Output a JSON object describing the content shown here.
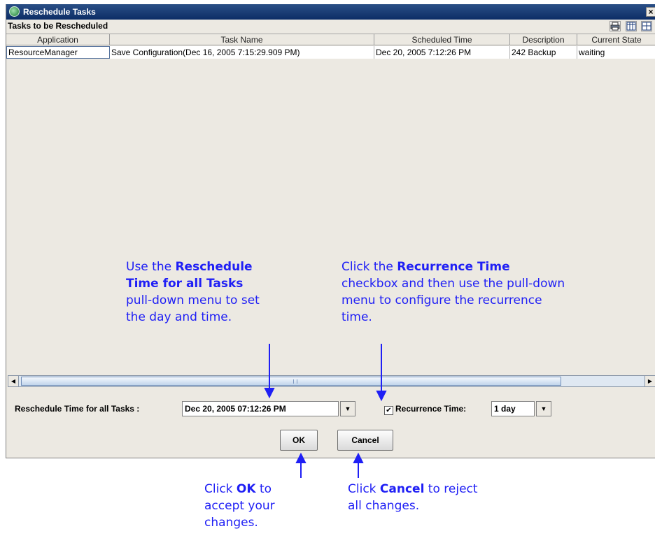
{
  "window": {
    "title": "Reschedule Tasks",
    "close_label": "×",
    "section_label": "Tasks to be Rescheduled"
  },
  "toolbar": {
    "icons": [
      "print-icon",
      "grid-columns-icon",
      "grid-layout-icon"
    ]
  },
  "table": {
    "columns": [
      "Application",
      "Task Name",
      "Scheduled Time",
      "Description",
      "Current State"
    ],
    "rows": [
      [
        "ResourceManager",
        "Save Configuration(Dec 16, 2005 7:15:29.909 PM)",
        "Dec 20, 2005 7:12:26 PM",
        "242 Backup",
        "waiting"
      ]
    ]
  },
  "scrollbar": {
    "left_arrow": "◀",
    "right_arrow": "▶"
  },
  "bottom": {
    "reschedule_label": "Reschedule Time for all Tasks :",
    "reschedule_value": "Dec 20, 2005 07:12:26 PM",
    "recurrence_checked_glyph": "✔",
    "recurrence_label": "Recurrence Time:",
    "recurrence_value": "1 day",
    "dropdown_glyph": "▼",
    "ok_label": "OK",
    "cancel_label": "Cancel"
  },
  "callouts": {
    "reschedule": {
      "l1": "Use the ",
      "l1b": "Reschedule",
      "l2b": "Time for all Tasks",
      "l3": "pull-down menu to set",
      "l4": "the day and time."
    },
    "recurrence": {
      "l1": "Click the ",
      "l1b": "Recurrence Time",
      "l2": "checkbox and then use the pull-down",
      "l3": "menu to configure the recurrence",
      "l4": "time."
    },
    "ok": {
      "l1": "Click ",
      "l1b": "OK",
      "l1c": " to",
      "l2": "accept your",
      "l3": "changes."
    },
    "cancel": {
      "l1": "Click ",
      "l1b": "Cancel",
      "l1c": " to reject",
      "l2": "all changes."
    }
  },
  "colors": {
    "callout_text": "#1f1ff5",
    "titlebar": "#0c2d66",
    "window_bg": "#ece9e2"
  }
}
